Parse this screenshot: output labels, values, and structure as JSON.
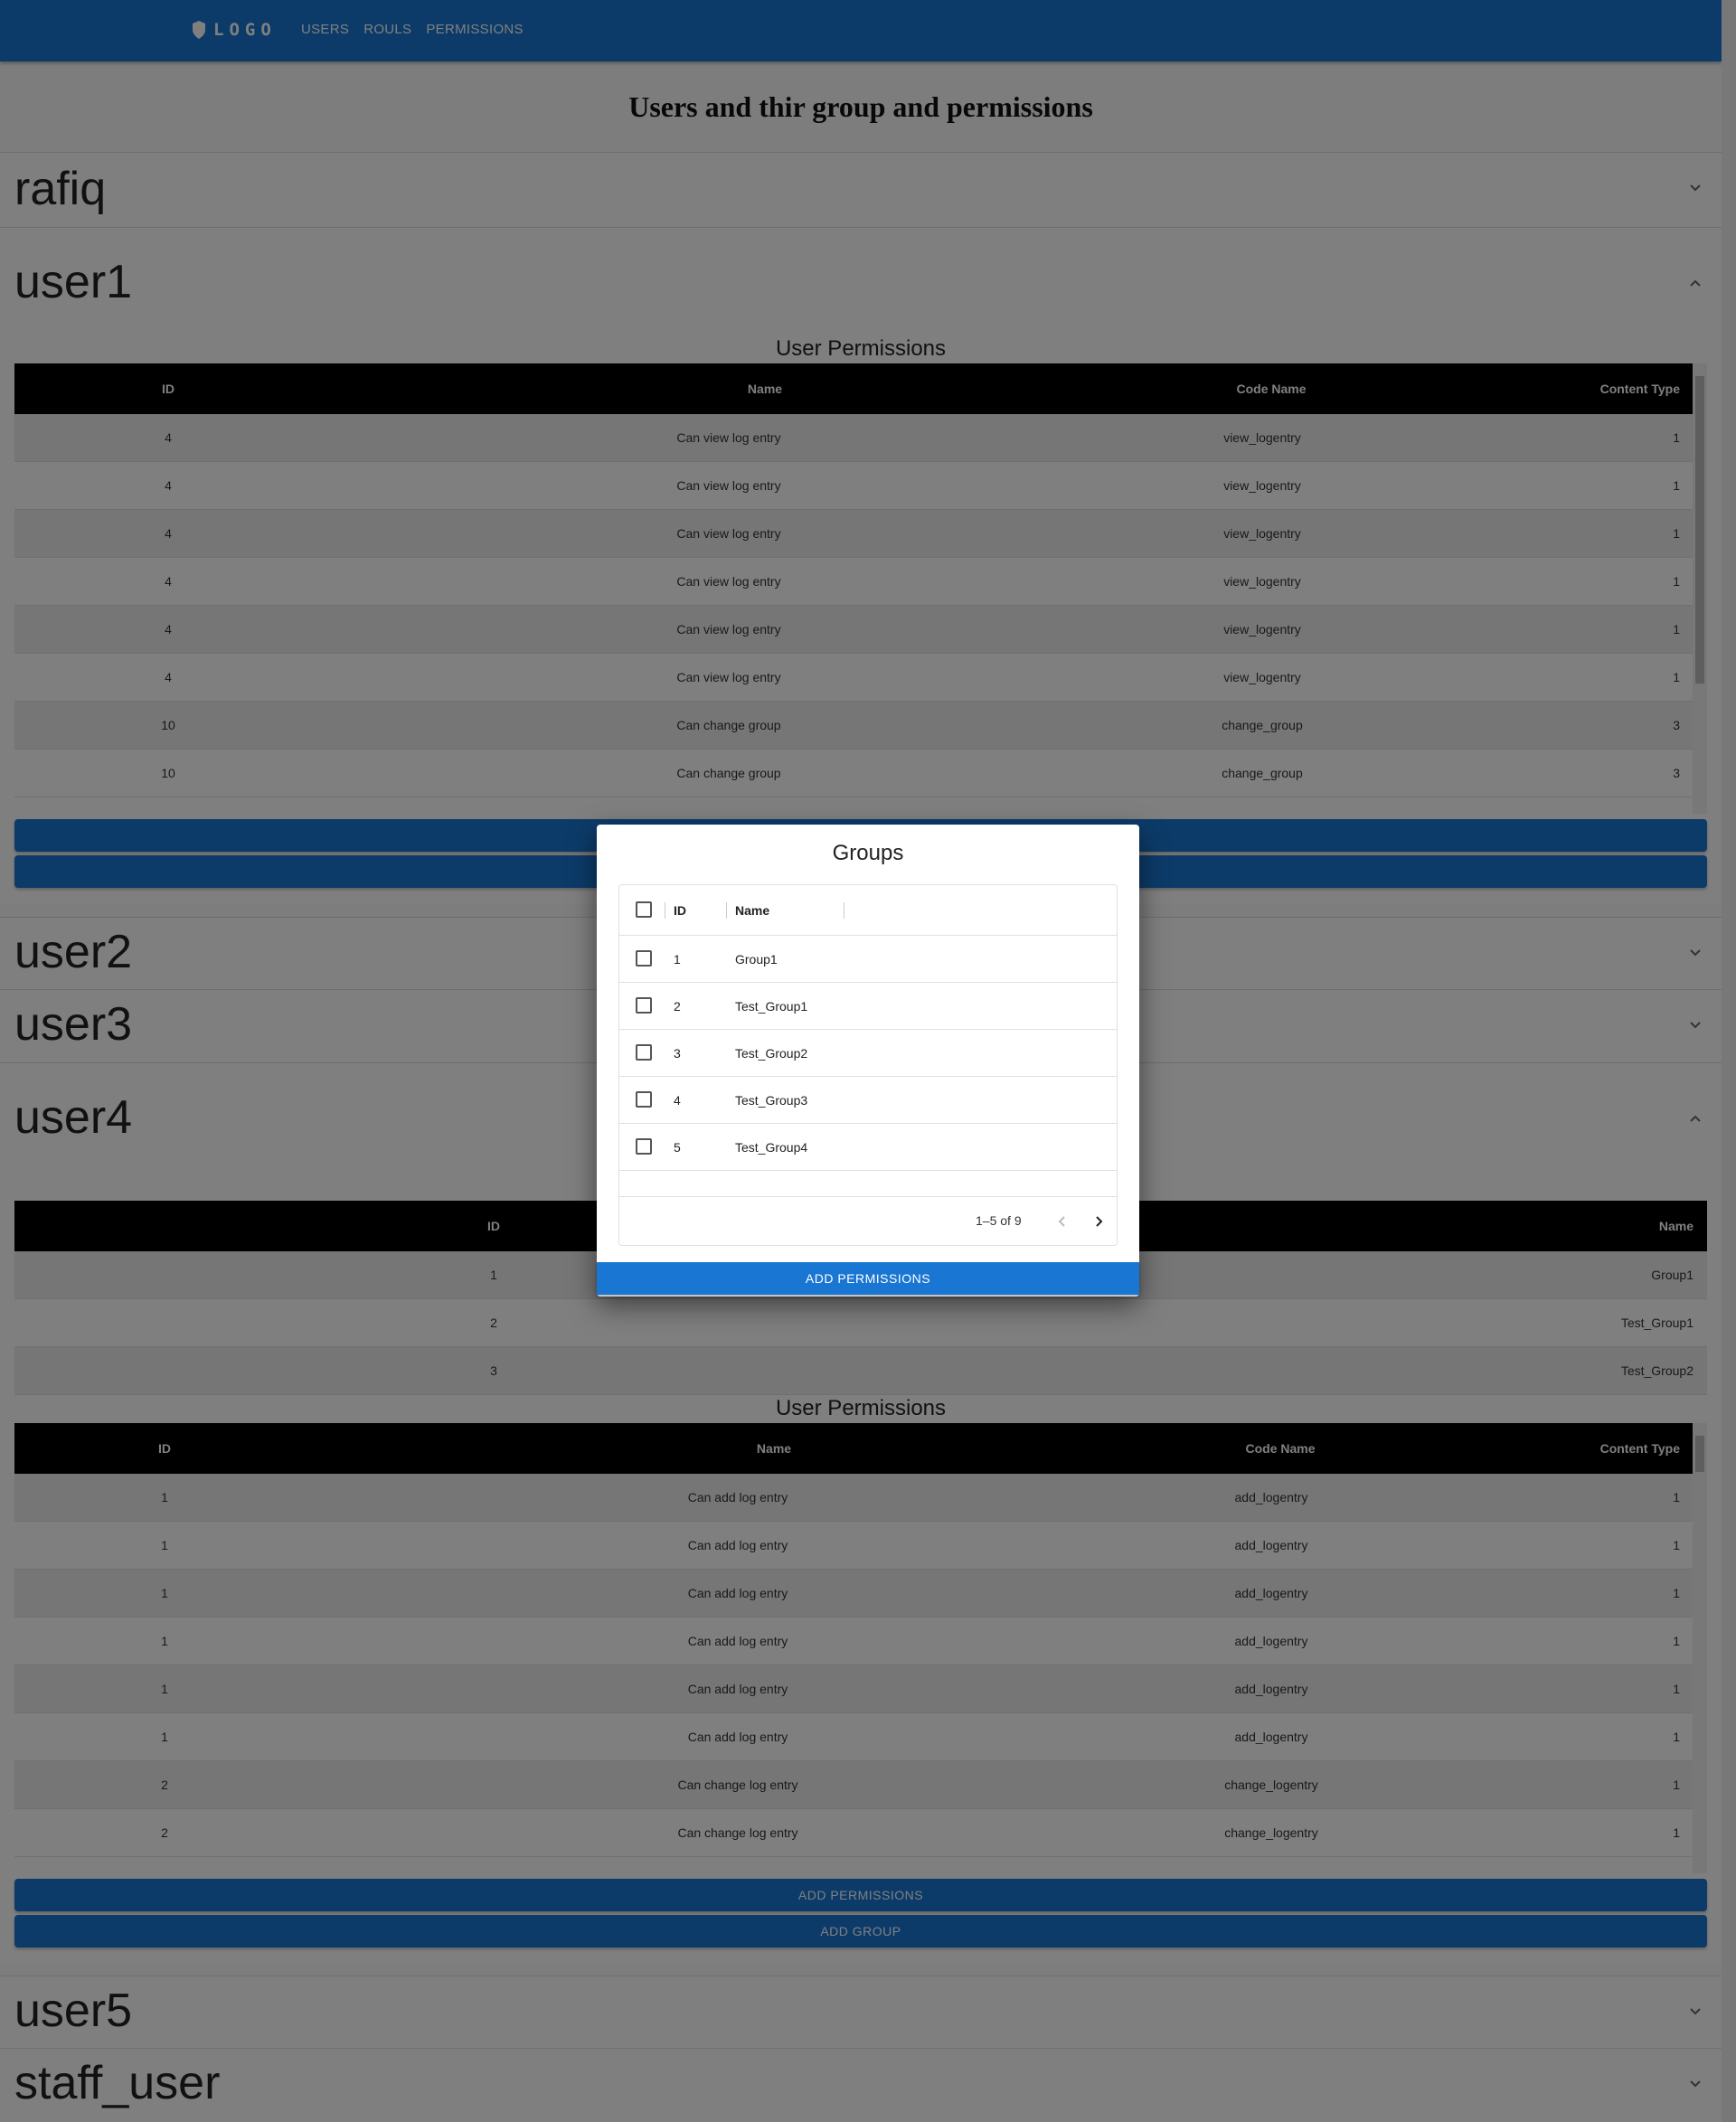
{
  "appbar": {
    "logo_text": "LOGO",
    "logo_icon": "shield-icon",
    "nav": [
      "USERS",
      "ROULS",
      "PERMISSIONS"
    ],
    "color": "#1976d2"
  },
  "page_title": "Users and thir group and permissions",
  "accordions": {
    "rafiq": "rafiq",
    "user1": "user1",
    "user2": "user2",
    "user3": "user3",
    "user4": "user4",
    "user5": "user5",
    "staff_user": "staff_user"
  },
  "user1_section": {
    "permissions_title": "User Permissions",
    "columns": [
      "ID",
      "Name",
      "Code Name",
      "Content Type"
    ],
    "rows": [
      [
        "4",
        "Can view log entry",
        "view_logentry",
        "1"
      ],
      [
        "4",
        "Can view log entry",
        "view_logentry",
        "1"
      ],
      [
        "4",
        "Can view log entry",
        "view_logentry",
        "1"
      ],
      [
        "4",
        "Can view log entry",
        "view_logentry",
        "1"
      ],
      [
        "4",
        "Can view log entry",
        "view_logentry",
        "1"
      ],
      [
        "4",
        "Can view log entry",
        "view_logentry",
        "1"
      ],
      [
        "10",
        "Can change group",
        "change_group",
        "3"
      ],
      [
        "10",
        "Can change group",
        "change_group",
        "3"
      ]
    ]
  },
  "user4_section": {
    "groups_columns": [
      "ID",
      "Name"
    ],
    "groups_rows": [
      [
        "1",
        "Group1"
      ],
      [
        "2",
        "Test_Group1"
      ],
      [
        "3",
        "Test_Group2"
      ]
    ],
    "permissions_title": "User Permissions",
    "columns": [
      "ID",
      "Name",
      "Code Name",
      "Content Type"
    ],
    "rows": [
      [
        "1",
        "Can add log entry",
        "add_logentry",
        "1"
      ],
      [
        "1",
        "Can add log entry",
        "add_logentry",
        "1"
      ],
      [
        "1",
        "Can add log entry",
        "add_logentry",
        "1"
      ],
      [
        "1",
        "Can add log entry",
        "add_logentry",
        "1"
      ],
      [
        "1",
        "Can add log entry",
        "add_logentry",
        "1"
      ],
      [
        "1",
        "Can add log entry",
        "add_logentry",
        "1"
      ],
      [
        "2",
        "Can change log entry",
        "change_logentry",
        "1"
      ],
      [
        "2",
        "Can change log entry",
        "change_logentry",
        "1"
      ]
    ],
    "add_permissions": "ADD PERMISSIONS",
    "add_group": "ADD GROUP"
  },
  "dialog": {
    "title": "Groups",
    "columns": [
      "ID",
      "Name"
    ],
    "rows": [
      [
        "1",
        "Group1"
      ],
      [
        "2",
        "Test_Group1"
      ],
      [
        "3",
        "Test_Group2"
      ],
      [
        "4",
        "Test_Group3"
      ],
      [
        "5",
        "Test_Group4"
      ]
    ],
    "pagination": "1–5 of 9",
    "button": "ADD PERMISSIONS"
  }
}
